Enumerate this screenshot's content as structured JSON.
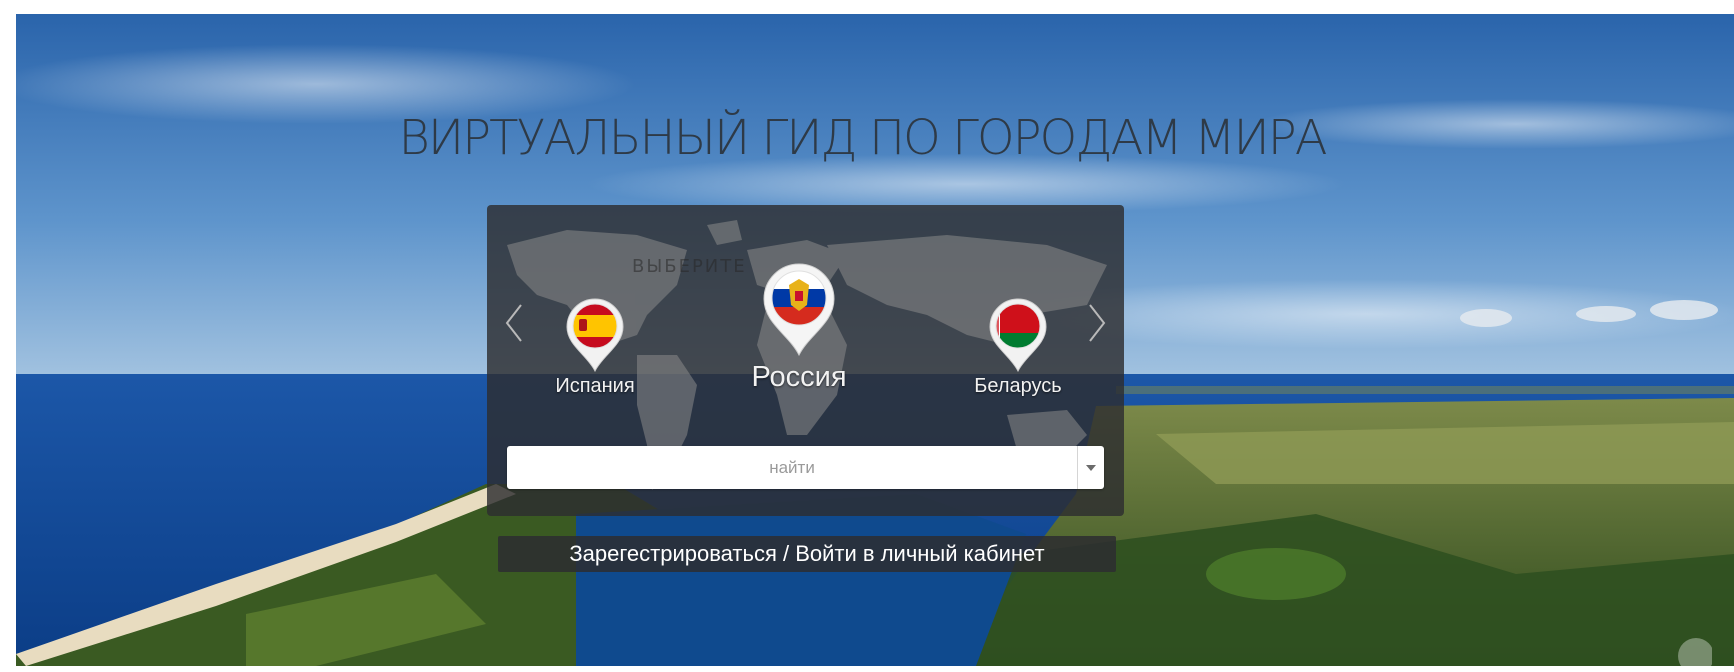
{
  "hero": {
    "title": "ВИРТУАЛЬНЫЙ ГИД ПО ГОРОДАМ МИРА"
  },
  "selector": {
    "obscured_text": "ВЫБЕРИТЕ",
    "countries": [
      {
        "name": "Испания",
        "flag": "spain-flag",
        "selected": false
      },
      {
        "name": "Россия",
        "flag": "russia-flag",
        "selected": true
      },
      {
        "name": "Беларусь",
        "flag": "belarus-flag",
        "selected": false
      }
    ],
    "prev_icon": "chevron-left-icon",
    "next_icon": "chevron-right-icon"
  },
  "search": {
    "placeholder": "найти",
    "value": ""
  },
  "auth": {
    "label": "Зарегестрироваться / Войти в личный кабинет"
  },
  "colors": {
    "panel": "#2d2d30",
    "title": "#2e3a47",
    "sea": "#0d4a9c",
    "sky": "#2f6fb3"
  }
}
